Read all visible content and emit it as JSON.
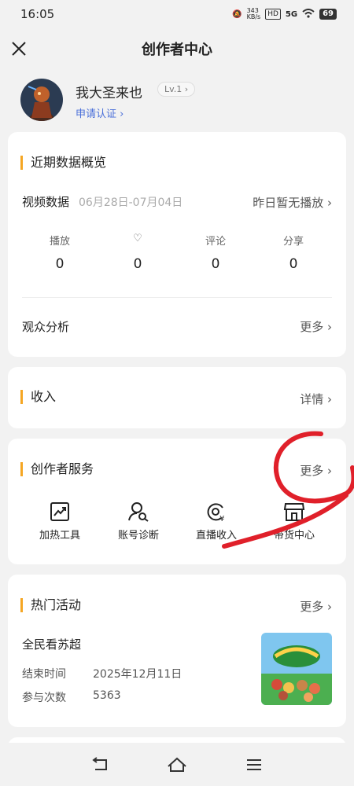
{
  "status_bar": {
    "time": "16:05",
    "net_speed": "343\nKB/s",
    "hd": "HD",
    "signal": "5G",
    "battery": "69"
  },
  "header": {
    "title": "创作者中心"
  },
  "profile": {
    "name": "我大圣来也",
    "level": "Lv.1 ›",
    "apply": "申请认证 ›"
  },
  "overview": {
    "title": "近期数据概览",
    "video_label": "视频数据",
    "date_range": "06月28日-07月04日",
    "yesterday": "昨日暂无播放 ›",
    "stats": [
      {
        "label": "播放",
        "value": "0"
      },
      {
        "label": "♡",
        "value": "0"
      },
      {
        "label": "评论",
        "value": "0"
      },
      {
        "label": "分享",
        "value": "0"
      }
    ],
    "audience_label": "观众分析",
    "more": "更多 ›"
  },
  "income": {
    "title": "收入",
    "detail": "详情 ›"
  },
  "services": {
    "title": "创作者服务",
    "more": "更多 ›",
    "items": [
      {
        "label": "加热工具",
        "icon": "trend-up-icon"
      },
      {
        "label": "账号诊断",
        "icon": "user-search-icon"
      },
      {
        "label": "直播收入",
        "icon": "live-income-icon"
      },
      {
        "label": "带货中心",
        "icon": "store-icon"
      }
    ]
  },
  "events": {
    "title": "热门活动",
    "more": "更多 ›",
    "event_name": "全民看苏超",
    "end_label": "结束时间",
    "end_value": "2025年12月11日",
    "count_label": "参与次数",
    "count_value": "5363"
  },
  "colors": {
    "accent": "#f5a623",
    "annotation": "#e0202a",
    "link": "#4a6fd9"
  }
}
